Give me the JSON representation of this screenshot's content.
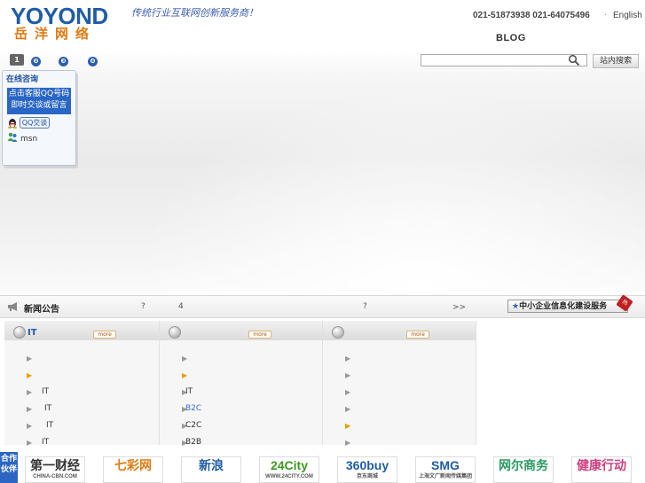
{
  "header": {
    "logo_en": "YOYOND",
    "logo_cn": "岳洋网络",
    "slogan": "传统行业互联网创新服务商！",
    "phones": "021-51873938  021-64075496",
    "lang_separator": "·",
    "lang": "English",
    "blog": "BLOG"
  },
  "banner": {
    "slides": [
      "1",
      "❷",
      "❸",
      "❹"
    ],
    "search": {
      "placeholder": "",
      "button": "站内搜索"
    }
  },
  "chat": {
    "title": "在线咨询",
    "message": "点击客服QQ号码即时交谈或留言",
    "qq_button": "QQ交谈",
    "msn_label": "msn"
  },
  "news": {
    "title": "新闻公告",
    "items": [
      "?",
      "4",
      "?"
    ],
    "more": ">>",
    "sme_banner": "中小企业信息化建设服务",
    "sme_tag": "热"
  },
  "panels": [
    {
      "title": "IT",
      "more": "more",
      "items": [
        {
          "arrow": "▶",
          "hot": false,
          "text": "",
          "link": false
        },
        {
          "arrow": "▶",
          "hot": true,
          "text": "",
          "link": false
        },
        {
          "arrow": "▶",
          "hot": false,
          "text": "IT",
          "link": false
        },
        {
          "arrow": "▶",
          "hot": false,
          "text": "IT",
          "link": false
        },
        {
          "arrow": "▶",
          "hot": false,
          "text": "IT",
          "link": false
        },
        {
          "arrow": "▶",
          "hot": false,
          "text": "IT",
          "link": false
        }
      ]
    },
    {
      "title": "",
      "more": "more",
      "items": [
        {
          "arrow": "▶",
          "hot": false,
          "text": "",
          "link": false
        },
        {
          "arrow": "▶",
          "hot": true,
          "text": "",
          "link": false
        },
        {
          "arrow": "▶",
          "hot": false,
          "text": "IT",
          "link": false
        },
        {
          "arrow": "▶",
          "hot": false,
          "text": "B2C",
          "link": true
        },
        {
          "arrow": "▶",
          "hot": false,
          "text": "C2C",
          "link": false
        },
        {
          "arrow": "▶",
          "hot": false,
          "text": "B2B",
          "link": false
        }
      ]
    },
    {
      "title": "",
      "more": "more",
      "items": [
        {
          "arrow": "▶",
          "hot": false,
          "text": "",
          "link": false
        },
        {
          "arrow": "▶",
          "hot": false,
          "text": "",
          "link": false
        },
        {
          "arrow": "▶",
          "hot": false,
          "text": "",
          "link": false
        },
        {
          "arrow": "▶",
          "hot": false,
          "text": "",
          "link": false
        },
        {
          "arrow": "▶",
          "hot": true,
          "text": "",
          "link": false
        },
        {
          "arrow": "▶",
          "hot": false,
          "text": "",
          "link": false
        }
      ]
    }
  ],
  "partners": {
    "label": "合作伙伴",
    "logos": [
      {
        "name": "第一财经",
        "sub": "CHINA-CBN.COM",
        "color": "#333333"
      },
      {
        "name": "七彩网",
        "sub": "",
        "color": "#e07a10"
      },
      {
        "name": "新浪",
        "sub": "",
        "color": "#1f5ca8"
      },
      {
        "name": "24City",
        "sub": "WWW.24CITY.COM",
        "color": "#3a9a20"
      },
      {
        "name": "360buy",
        "sub": "京东商城",
        "color": "#1f5ca8"
      },
      {
        "name": "SMG",
        "sub": "上海文广新闻传媒集团",
        "color": "#1f5ca8"
      },
      {
        "name": "网尔商务",
        "sub": "",
        "color": "#2a9a60"
      },
      {
        "name": "健康行动",
        "sub": "",
        "color": "#d04080"
      }
    ]
  }
}
